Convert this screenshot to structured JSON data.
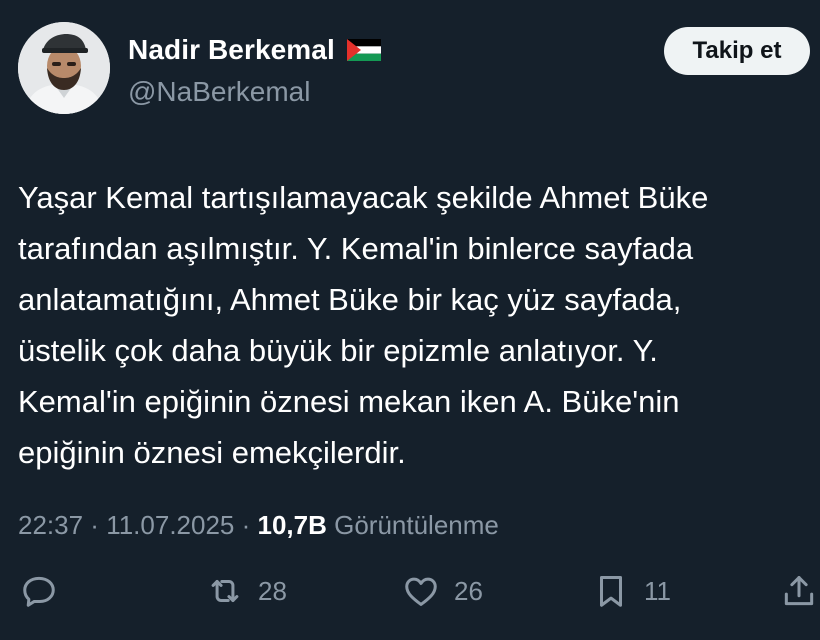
{
  "author": {
    "name": "Nadir Berkemal",
    "handle": "@NaBerkemal",
    "flag_icon": "palestine-flag-icon"
  },
  "follow_button": {
    "label": "Takip et"
  },
  "tweet": {
    "text": "Yaşar Kemal tartışılamayacak şekilde Ahmet Büke\ntarafından aşılmıştır. Y. Kemal'in binlerce sayfada\nanlatamatığını, Ahmet Büke bir kaç yüz sayfada,\nüstelik çok daha büyük bir epizmle anlatıyor. Y.\nKemal'in epiğinin öznesi mekan iken A. Büke'nin\nepiğinin öznesi emekçilerdir."
  },
  "meta": {
    "time": "22:37",
    "sep1": " · ",
    "date": "11.07.2025",
    "sep2": " · ",
    "views": "10,7B",
    "views_label": " Görüntülenme"
  },
  "actions": {
    "reply": {
      "icon": "reply-icon",
      "count": ""
    },
    "retweet": {
      "icon": "retweet-icon",
      "count": "28"
    },
    "like": {
      "icon": "heart-icon",
      "count": "26"
    },
    "bookmark": {
      "icon": "bookmark-icon",
      "count": "11"
    },
    "share": {
      "icon": "share-icon",
      "count": ""
    }
  },
  "colors": {
    "background": "#15202b",
    "text": "#ffffff",
    "secondary": "#8b98a5",
    "button_bg": "#eff3f4"
  }
}
